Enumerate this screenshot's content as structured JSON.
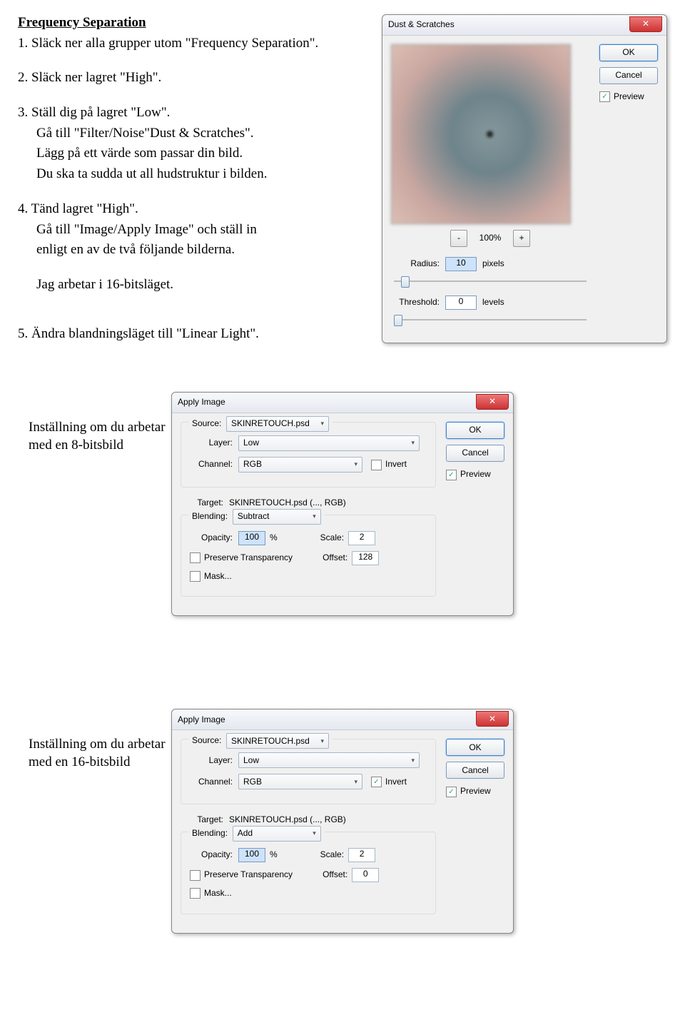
{
  "doc": {
    "title": "Frequency Separation",
    "step1": "1.  Släck ner alla grupper utom \"Frequency Separation\".",
    "step2": "2.  Släck ner lagret \"High\".",
    "step3a": "3.  Ställ dig på lagret \"Low\".",
    "step3b": "Gå till \"Filter/Noise\"Dust & Scratches\".",
    "step3c": "Lägg på ett värde som passar din bild.",
    "step3d": "Du ska ta sudda ut all hudstruktur i bilden.",
    "step4a": "4.  Tänd lagret \"High\".",
    "step4b": "Gå till \"Image/Apply Image\" och ställ in",
    "step4c": "enligt en av de två följande bilderna.",
    "note": "Jag arbetar i 16-bitsläget.",
    "step5": "5.  Ändra blandningsläget till \"Linear Light\".",
    "label8": "Inställning om du arbetar med en 8-bitsbild",
    "label16": "Inställning om du arbetar med en 16-bitsbild"
  },
  "dust": {
    "title": "Dust & Scratches",
    "ok": "OK",
    "cancel": "Cancel",
    "preview": "Preview",
    "zoom": "100%",
    "radius_label": "Radius:",
    "radius_value": "10",
    "radius_unit": "pixels",
    "threshold_label": "Threshold:",
    "threshold_value": "0",
    "threshold_unit": "levels"
  },
  "apply8": {
    "title": "Apply Image",
    "ok": "OK",
    "cancel": "Cancel",
    "preview": "Preview",
    "source_lbl": "Source:",
    "source_val": "SKINRETOUCH.psd",
    "layer_lbl": "Layer:",
    "layer_val": "Low",
    "channel_lbl": "Channel:",
    "channel_val": "RGB",
    "invert": "Invert",
    "invert_checked": false,
    "target_lbl": "Target:",
    "target_val": "SKINRETOUCH.psd (..., RGB)",
    "blending_lbl": "Blending:",
    "blending_val": "Subtract",
    "opacity_lbl": "Opacity:",
    "opacity_val": "100",
    "opacity_unit": "%",
    "scale_lbl": "Scale:",
    "scale_val": "2",
    "preserve": "Preserve Transparency",
    "offset_lbl": "Offset:",
    "offset_val": "128",
    "mask": "Mask..."
  },
  "apply16": {
    "title": "Apply Image",
    "ok": "OK",
    "cancel": "Cancel",
    "preview": "Preview",
    "source_lbl": "Source:",
    "source_val": "SKINRETOUCH.psd",
    "layer_lbl": "Layer:",
    "layer_val": "Low",
    "channel_lbl": "Channel:",
    "channel_val": "RGB",
    "invert": "Invert",
    "invert_checked": true,
    "target_lbl": "Target:",
    "target_val": "SKINRETOUCH.psd (..., RGB)",
    "blending_lbl": "Blending:",
    "blending_val": "Add",
    "opacity_lbl": "Opacity:",
    "opacity_val": "100",
    "opacity_unit": "%",
    "scale_lbl": "Scale:",
    "scale_val": "2",
    "preserve": "Preserve Transparency",
    "offset_lbl": "Offset:",
    "offset_val": "0",
    "mask": "Mask..."
  }
}
